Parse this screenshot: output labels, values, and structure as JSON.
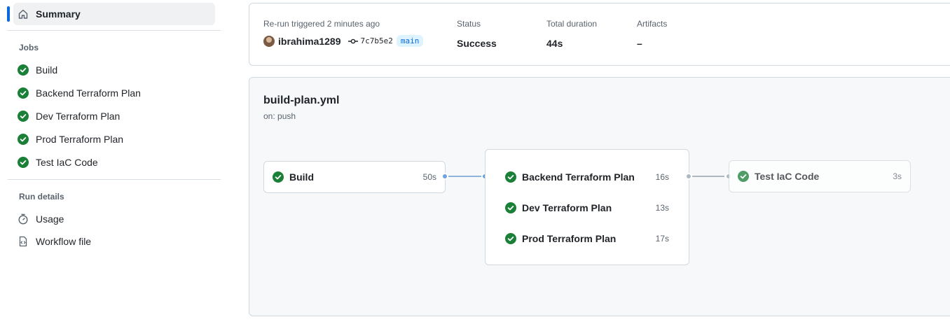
{
  "sidebar": {
    "summary_label": "Summary",
    "jobs_heading": "Jobs",
    "jobs": [
      {
        "label": "Build",
        "icon": "check-circle-icon"
      },
      {
        "label": "Backend Terraform Plan",
        "icon": "check-circle-icon"
      },
      {
        "label": "Dev Terraform Plan",
        "icon": "check-circle-icon"
      },
      {
        "label": "Prod Terraform Plan",
        "icon": "check-circle-icon"
      },
      {
        "label": "Test IaC Code",
        "icon": "check-circle-icon"
      }
    ],
    "run_details_heading": "Run details",
    "run_details": [
      {
        "label": "Usage",
        "icon": "stopwatch-icon"
      },
      {
        "label": "Workflow file",
        "icon": "file-code-icon"
      }
    ]
  },
  "summary": {
    "trigger_label": "Re-run triggered 2 minutes ago",
    "user": "ibrahima1289",
    "commit": "7c7b5e2",
    "branch": "main",
    "status_label": "Status",
    "status_value": "Success",
    "duration_label": "Total duration",
    "duration_value": "44s",
    "artifacts_label": "Artifacts",
    "artifacts_value": "–"
  },
  "workflow": {
    "file": "build-plan.yml",
    "trigger": "on: push",
    "build": {
      "label": "Build",
      "duration": "50s"
    },
    "plans": [
      {
        "label": "Backend Terraform Plan",
        "duration": "16s"
      },
      {
        "label": "Dev Terraform Plan",
        "duration": "13s"
      },
      {
        "label": "Prod Terraform Plan",
        "duration": "17s"
      }
    ],
    "test": {
      "label": "Test IaC Code",
      "duration": "3s"
    }
  },
  "colors": {
    "success": "#1a7f37",
    "accent": "#0969da"
  }
}
